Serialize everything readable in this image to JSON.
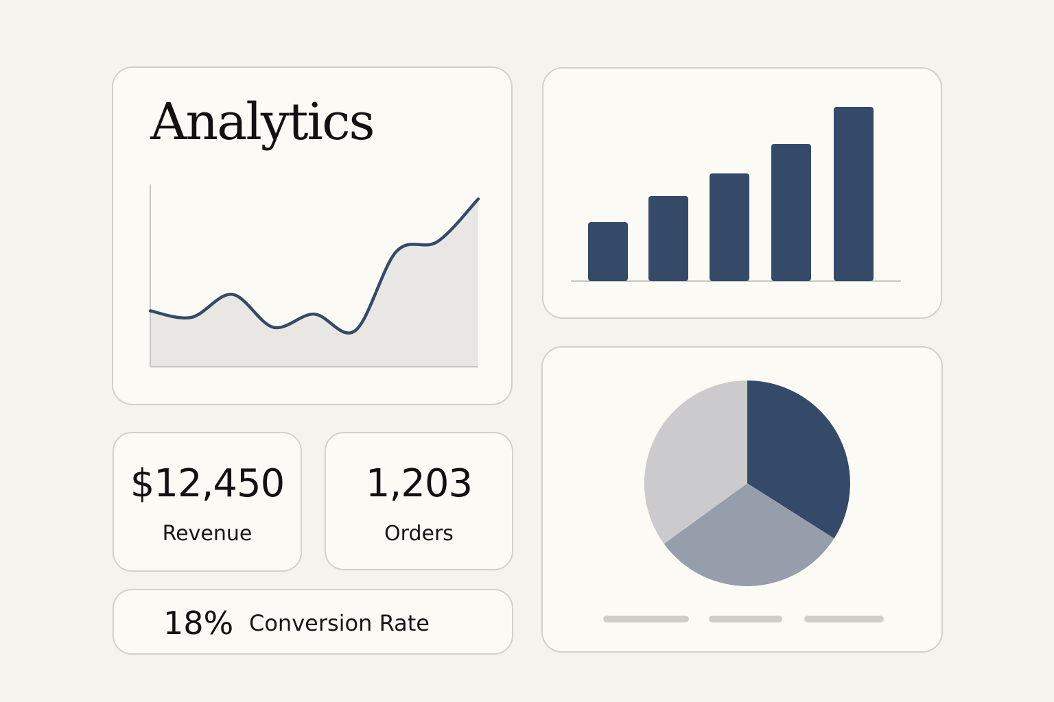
{
  "header": {
    "title": "Analytics"
  },
  "colors": {
    "background": "#f6f3ee",
    "card": "#fcfaf5",
    "card_border": "#d2d0cc",
    "accent": "#354a69",
    "area_fill": "#e8e7e4",
    "slice_mid": "#969dab",
    "slice_light": "#cbcbce"
  },
  "kpis": {
    "revenue": {
      "value": "$12,450",
      "label": "Revenue"
    },
    "orders": {
      "value": "1,203",
      "label": "Orders"
    },
    "conversion": {
      "value": "18%",
      "label": "Conversion Rate"
    }
  },
  "chart_data": [
    {
      "type": "area",
      "x": [
        0,
        1,
        2,
        3,
        4,
        5,
        6,
        7,
        8
      ],
      "values": [
        17,
        15,
        22,
        12,
        16,
        11,
        35,
        38,
        51
      ],
      "xlabel": "",
      "ylabel": "",
      "grid": false,
      "line_color": "#354a69",
      "fill_color": "#e8e7e4"
    },
    {
      "type": "bar",
      "values": [
        86,
        124,
        157,
        200,
        254
      ],
      "grid": false,
      "color": "#354a69"
    },
    {
      "type": "pie",
      "values": [
        34,
        31,
        35
      ],
      "colors": [
        "#354a69",
        "#969dab",
        "#cbcbce"
      ],
      "legend": [
        "",
        "",
        ""
      ]
    }
  ]
}
